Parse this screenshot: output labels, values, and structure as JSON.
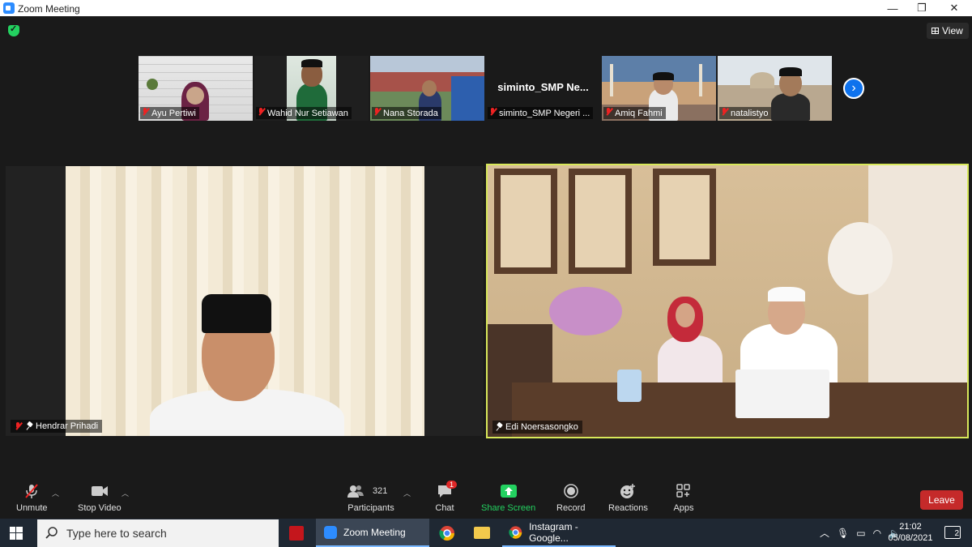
{
  "window": {
    "title": "Zoom Meeting"
  },
  "view_button": {
    "label": "View"
  },
  "gallery": [
    {
      "name": "Ayu Pertiwi"
    },
    {
      "name": "Wahid Nur Setiawan"
    },
    {
      "name": "Nana Storada"
    },
    {
      "name": "siminto_SMP Negeri ...",
      "display_text": "siminto_SMP  Ne..."
    },
    {
      "name": "Amiq Fahmi"
    },
    {
      "name": "natalistyo"
    }
  ],
  "main_tiles": [
    {
      "name": "Hendrar Prihadi"
    },
    {
      "name": "Edi Noersasongko"
    }
  ],
  "toolbar": {
    "unmute": "Unmute",
    "stop_video": "Stop Video",
    "participants": "Participants",
    "participants_count": "321",
    "chat": "Chat",
    "chat_badge": "1",
    "share_screen": "Share Screen",
    "record": "Record",
    "reactions": "Reactions",
    "apps": "Apps",
    "leave": "Leave"
  },
  "taskbar": {
    "search_placeholder": "Type here to search",
    "zoom_app": "Zoom Meeting",
    "chrome_window": "Instagram - Google...",
    "time": "21:02",
    "date": "05/08/2021",
    "notifications": "2"
  },
  "colors": {
    "share_green": "#23d160",
    "active_speaker_border": "#d8e85a",
    "leave_red": "#c52a2a",
    "zoom_blue": "#2d8cff"
  }
}
